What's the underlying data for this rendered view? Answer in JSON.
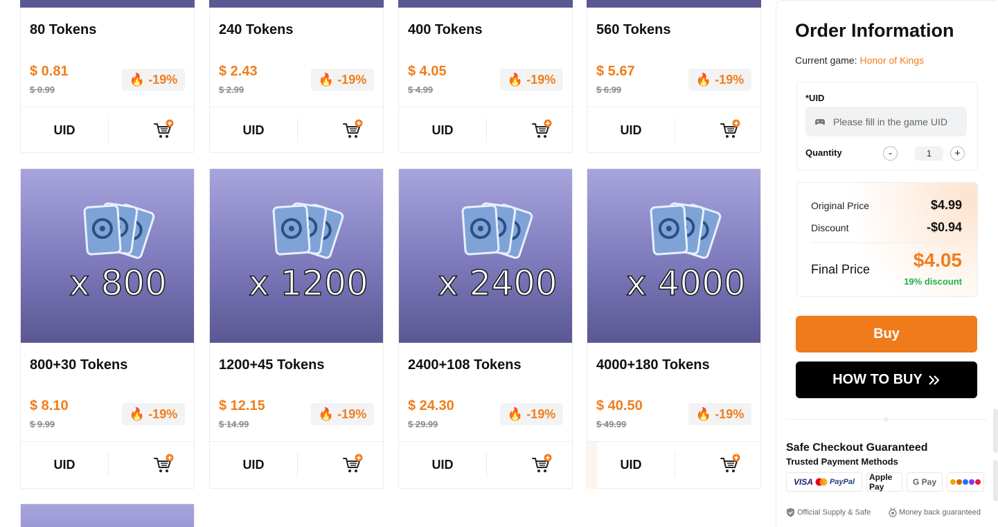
{
  "products": [
    {
      "title": "80 Tokens",
      "price": "$ 0.81",
      "old_price": "$ 0.99",
      "discount": "-19%",
      "uid_label": "UID"
    },
    {
      "title": "240 Tokens",
      "price": "$ 2.43",
      "old_price": "$ 2.99",
      "discount": "-19%",
      "uid_label": "UID"
    },
    {
      "title": "400 Tokens",
      "price": "$ 4.05",
      "old_price": "$ 4.99",
      "discount": "-19%",
      "uid_label": "UID"
    },
    {
      "title": "560 Tokens",
      "price": "$ 5.67",
      "old_price": "$ 6.99",
      "discount": "-19%",
      "uid_label": "UID"
    },
    {
      "title": "800+30 Tokens",
      "price": "$ 8.10",
      "old_price": "$ 9.99",
      "discount": "-19%",
      "uid_label": "UID",
      "qty_label": "x 800"
    },
    {
      "title": "1200+45 Tokens",
      "price": "$ 12.15",
      "old_price": "$ 14.99",
      "discount": "-19%",
      "uid_label": "UID",
      "qty_label": "x 1200"
    },
    {
      "title": "2400+108 Tokens",
      "price": "$ 24.30",
      "old_price": "$ 29.99",
      "discount": "-19%",
      "uid_label": "UID",
      "qty_label": "x 2400"
    },
    {
      "title": "4000+180 Tokens",
      "price": "$ 40.50",
      "old_price": "$ 49.99",
      "discount": "-19%",
      "uid_label": "UID",
      "qty_label": "x 4000"
    }
  ],
  "order": {
    "title": "Order Information",
    "current_game_label": "Current game:",
    "current_game": "Honor of Kings",
    "uid_label": "*UID",
    "uid_placeholder": "Please fill in the game UID",
    "quantity_label": "Quantity",
    "quantity_minus": "-",
    "quantity_value": "1",
    "quantity_plus": "+",
    "original_price_label": "Original Price",
    "original_price": "$4.99",
    "discount_label": "Discount",
    "discount": "-$0.94",
    "final_price_label": "Final Price",
    "final_price": "$4.05",
    "discount_percent": "19% discount",
    "buy_label": "Buy",
    "how_to_buy_label": "HOW TO BUY",
    "safe_title": "Safe Checkout Guaranteed",
    "safe_subtitle": "Trusted Payment Methods",
    "payment_methods": [
      "VISA",
      "PayPal",
      "Apple Pay",
      "G Pay"
    ],
    "footer_official": "Official Supply & Safe",
    "footer_money_back": "Money back guaranteed"
  },
  "colors": {
    "accent": "#ef7b1b",
    "success": "#19b44c",
    "card_bg_top": "#a7a4dd",
    "card_bg_bottom": "#5a5793"
  }
}
